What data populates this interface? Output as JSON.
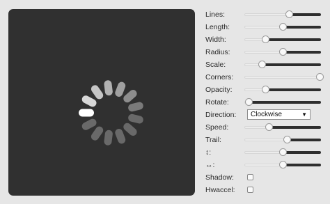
{
  "spinner": {
    "lines": 13,
    "trail_percent": 60,
    "direction": "Clockwise",
    "bar_color": "#ffffff",
    "background_color": "#303030"
  },
  "controls": {
    "lines": {
      "label": "Lines:",
      "value": 0.58
    },
    "length": {
      "label": "Length:",
      "value": 0.5
    },
    "width": {
      "label": "Width:",
      "value": 0.27
    },
    "radius": {
      "label": "Radius:",
      "value": 0.5
    },
    "scale": {
      "label": "Scale:",
      "value": 0.23
    },
    "corners": {
      "label": "Corners:",
      "value": 0.98
    },
    "opacity": {
      "label": "Opacity:",
      "value": 0.27
    },
    "rotate": {
      "label": "Rotate:",
      "value": 0.05
    },
    "direction": {
      "label": "Direction:",
      "value": "Clockwise",
      "arrow": "▼"
    },
    "speed": {
      "label": "Speed:",
      "value": 0.32
    },
    "trail": {
      "label": "Trail:",
      "value": 0.55
    },
    "top": {
      "label": "↕:",
      "value": 0.5
    },
    "left": {
      "label": "↔:",
      "value": 0.5
    },
    "shadow": {
      "label": "Shadow:",
      "checked": false
    },
    "hwaccel": {
      "label": "Hwaccel:",
      "checked": false
    }
  }
}
